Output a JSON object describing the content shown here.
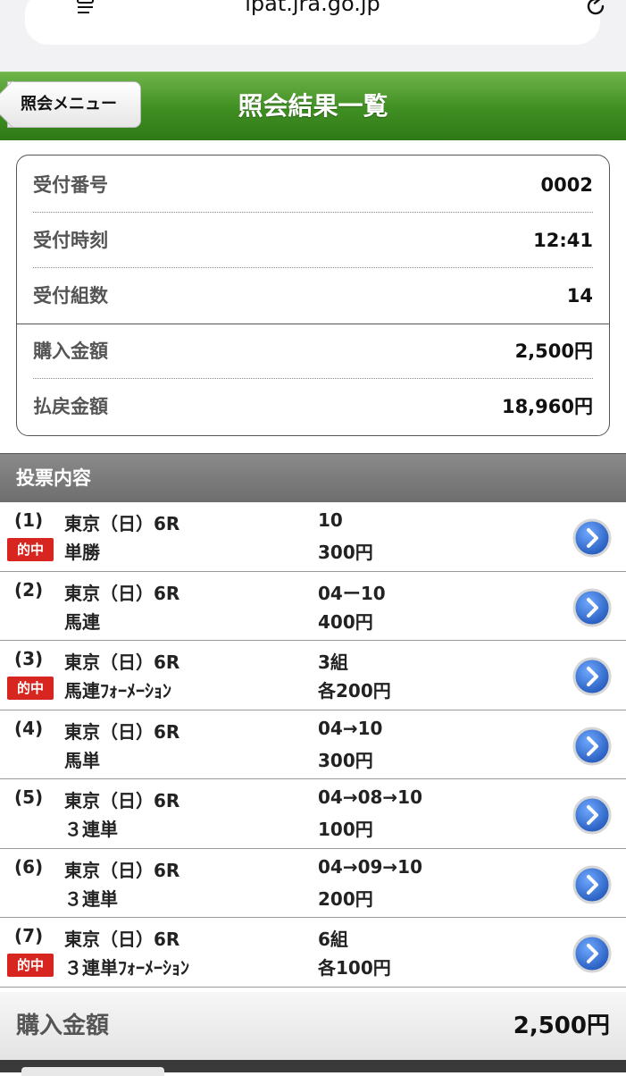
{
  "browser": {
    "url": "ipat.jra.go.jp"
  },
  "header": {
    "back_label": "照会メニュー",
    "title": "照会結果一覧"
  },
  "summary": {
    "rows": [
      {
        "label": "受付番号",
        "value": "0002"
      },
      {
        "label": "受付時刻",
        "value": "12:41"
      },
      {
        "label": "受付組数",
        "value": "14"
      },
      {
        "label": "購入金額",
        "value": "2,500円"
      },
      {
        "label": "払戻金額",
        "value": "18,960円"
      }
    ]
  },
  "section": {
    "title": "投票内容"
  },
  "bets": [
    {
      "num": "(1)",
      "race": "東京（日）6R",
      "type": "単勝",
      "combo": "10",
      "amount": "300円",
      "hit": true
    },
    {
      "num": "(2)",
      "race": "東京（日）6R",
      "type": "馬連",
      "combo": "04ー10",
      "amount": "400円",
      "hit": false
    },
    {
      "num": "(3)",
      "race": "東京（日）6R",
      "type": "馬連ﾌｫｰﾒｰｼｮﾝ",
      "combo": "3組",
      "amount": "各200円",
      "hit": true
    },
    {
      "num": "(4)",
      "race": "東京（日）6R",
      "type": "馬単",
      "combo": "04→10",
      "amount": "300円",
      "hit": false
    },
    {
      "num": "(5)",
      "race": "東京（日）6R",
      "type": "３連単",
      "combo": "04→08→10",
      "amount": "100円",
      "hit": false
    },
    {
      "num": "(6)",
      "race": "東京（日）6R",
      "type": "３連単",
      "combo": "04→09→10",
      "amount": "200円",
      "hit": false
    },
    {
      "num": "(7)",
      "race": "東京（日）6R",
      "type": "３連単ﾌｫｰﾒｰｼｮﾝ",
      "combo": "6組",
      "amount": "各100円",
      "hit": true
    }
  ],
  "hit_label": "的中",
  "footer": {
    "total_label": "購入金額",
    "total_value": "2,500円"
  },
  "colors": {
    "header_green": "#3f8e22",
    "hit_red": "#d6261f",
    "arrow_blue": "#2f6fd0"
  }
}
